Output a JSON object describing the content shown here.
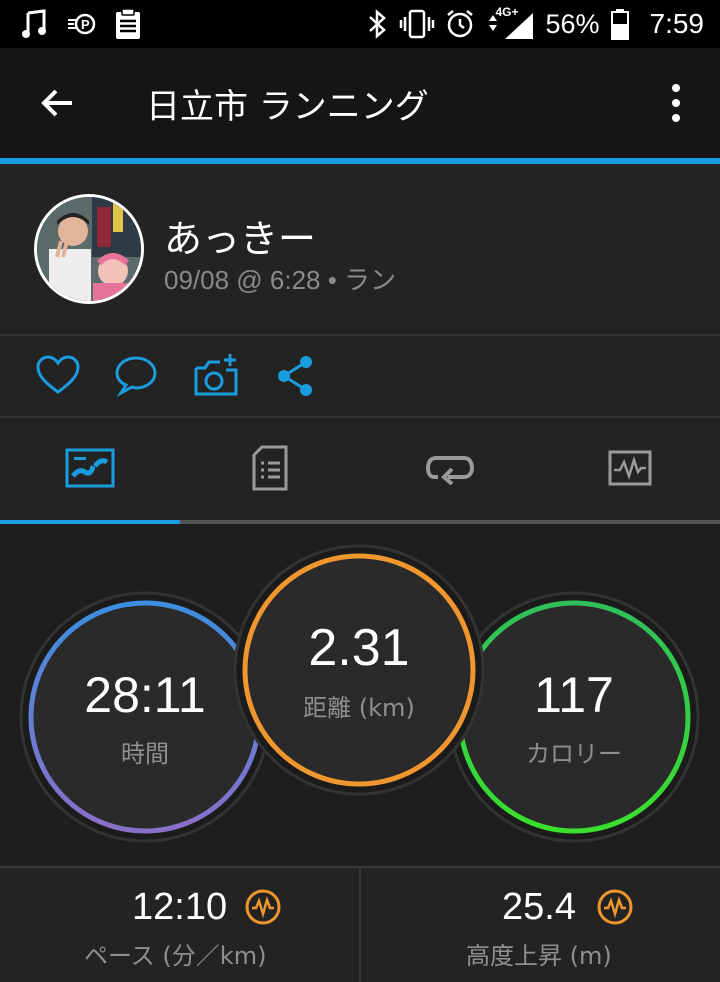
{
  "status_bar": {
    "battery_percent": "56%",
    "time": "7:59",
    "network": "4G+",
    "icons": [
      "music-note-icon",
      "parking-icon",
      "clipboard-icon",
      "bluetooth-icon",
      "vibrate-icon",
      "alarm-icon",
      "signal-icon",
      "battery-icon"
    ]
  },
  "app_bar": {
    "title": "日立市 ランニング",
    "back_icon": "arrow-left-icon",
    "menu_icon": "more-vert-icon"
  },
  "profile": {
    "name": "あっきー",
    "meta": "09/08 @ 6:28 • ラン"
  },
  "actions": {
    "icons": [
      "heart-icon",
      "comment-icon",
      "add-photo-icon",
      "share-icon"
    ],
    "accent_color": "#1a9ce0"
  },
  "tabs": {
    "icons": [
      "map-stats-icon",
      "details-icon",
      "laps-icon",
      "chart-icon"
    ],
    "selected_index": 0
  },
  "gauges": {
    "time": {
      "value": "28:11",
      "label": "時間",
      "colors": [
        "#3d8ee0",
        "#8a6fc8"
      ]
    },
    "distance": {
      "value": "2.31",
      "label": "距離 (km)",
      "color": "#f0962e"
    },
    "calories": {
      "value": "117",
      "label": "カロリー",
      "color": "#2fd34a"
    }
  },
  "stats": {
    "pace": {
      "value": "12:10",
      "label": "ペース (分／km)"
    },
    "elevation": {
      "value": "25.4",
      "label": "高度上昇 (m)"
    },
    "badge_color": "#f0962e"
  }
}
